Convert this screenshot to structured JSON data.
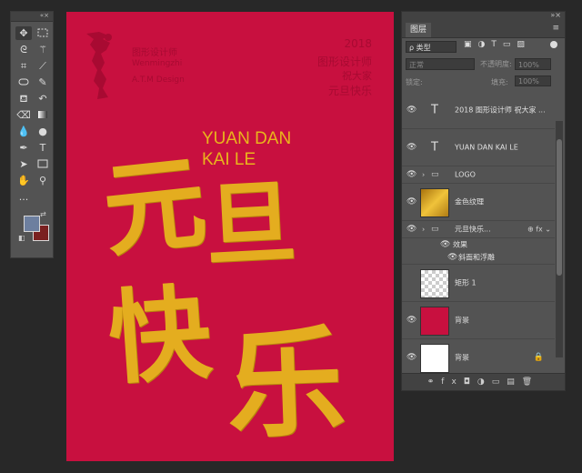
{
  "toolbox": {
    "tools": [
      "move",
      "marquee",
      "lasso",
      "magic-wand",
      "crop",
      "eyedropper",
      "spot-heal",
      "brush",
      "clone-stamp",
      "history-brush",
      "eraser",
      "gradient",
      "blur",
      "dodge",
      "pen",
      "type",
      "path-select",
      "rectangle",
      "hand",
      "zoom"
    ],
    "more": "..."
  },
  "colors": {
    "foreground": "#6d7f9f",
    "background": "#7a2020",
    "canvas": "#c8103f",
    "gold": "#e4ad1f"
  },
  "canvas": {
    "logo_name": "图形设计师",
    "logo_sub": "Wenmingzhi",
    "logo_meta": "A.T.M   Design",
    "right_lines": [
      "2018",
      "图形设计师",
      "祝大家",
      "元旦快乐"
    ],
    "yuan_dan": "YUAN DAN",
    "kai_le": "KAI LE",
    "calligraphy": [
      "元",
      "旦",
      "快",
      "乐"
    ]
  },
  "panel": {
    "tab": "图层",
    "menu_icon": "≡",
    "filter_label": "ρ 类型",
    "blend_mode": "正常",
    "opacity_label": "不透明度:",
    "opacity_value": "100%",
    "lock_label": "锁定:",
    "fill_label": "填充:",
    "fill_value": "100%",
    "layers": [
      {
        "name": "2018 图形设计师 祝大家 ...",
        "kind": "text"
      },
      {
        "name": "YUAN DAN KAI LE",
        "kind": "text"
      },
      {
        "name": "LOGO",
        "kind": "group"
      },
      {
        "name": "金色纹理",
        "kind": "image"
      },
      {
        "name": "元旦快乐...",
        "kind": "group"
      },
      {
        "name": "效果",
        "kind": "effect"
      },
      {
        "name": "斜面和浮雕",
        "kind": "effect"
      },
      {
        "name": "矩形 1",
        "kind": "shape"
      },
      {
        "name": "背景",
        "kind": "shape"
      },
      {
        "name": "背景",
        "kind": "background"
      }
    ]
  }
}
